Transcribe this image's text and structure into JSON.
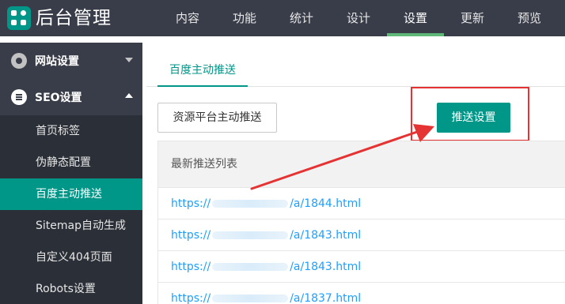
{
  "app": {
    "title": "后台管理"
  },
  "topnav": {
    "items": [
      {
        "label": "内容"
      },
      {
        "label": "功能"
      },
      {
        "label": "统计"
      },
      {
        "label": "设计"
      },
      {
        "label": "设置",
        "active": true
      },
      {
        "label": "更新"
      },
      {
        "label": "预览"
      }
    ]
  },
  "sidebar": {
    "groups": [
      {
        "label": "网站设置",
        "icon": "gear-icon",
        "expanded": false
      },
      {
        "label": "SEO设置",
        "icon": "menu-icon",
        "expanded": true
      }
    ],
    "items": [
      {
        "label": "首页标签"
      },
      {
        "label": "伪静态配置"
      },
      {
        "label": "百度主动推送",
        "active": true
      },
      {
        "label": "Sitemap自动生成"
      },
      {
        "label": "自定义404页面"
      },
      {
        "label": "Robots设置"
      }
    ]
  },
  "main": {
    "tab": "百度主动推送",
    "buttons": {
      "resource": "资源平台主动推送",
      "push_settings": "推送设置"
    },
    "table": {
      "header": "最新推送列表",
      "rows": [
        {
          "prefix": "https://",
          "suffix": "/a/1844.html"
        },
        {
          "prefix": "https://",
          "suffix": "/a/1843.html"
        },
        {
          "prefix": "https://",
          "suffix": "/a/1843.html"
        },
        {
          "prefix": "https://",
          "suffix": "/a/1837.html"
        }
      ]
    }
  },
  "colors": {
    "topbar": "#393d49",
    "sidebar": "#2b2f37",
    "accent": "#009688",
    "nav_underline": "#5fb878",
    "link": "#1e9fff",
    "annotation": "#e53333"
  }
}
